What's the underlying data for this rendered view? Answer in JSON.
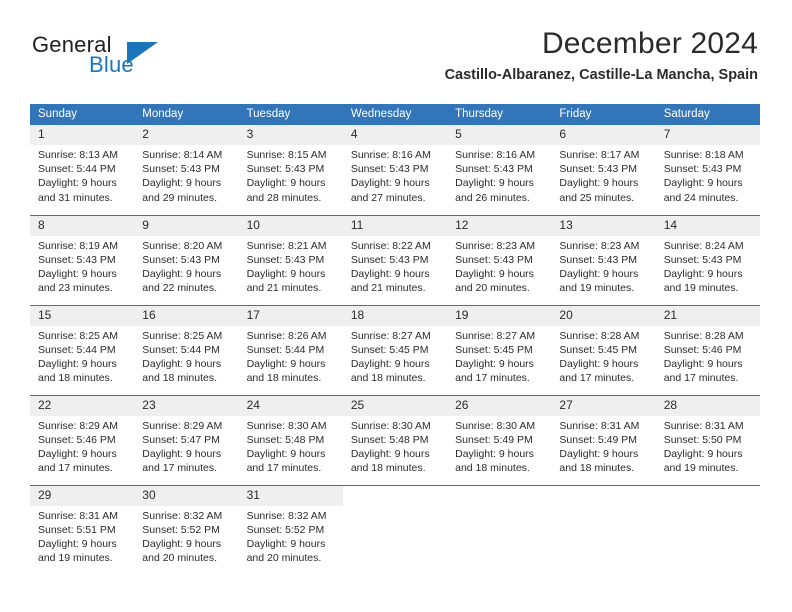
{
  "logo": {
    "word_one": "General",
    "word_two": "Blue",
    "triangle_color": "#1b75bb"
  },
  "header": {
    "title": "December 2024",
    "subtitle": "Castillo-Albaranez, Castille-La Mancha, Spain"
  },
  "theme": {
    "header_bg": "#3275b8",
    "daynum_bg": "#efefef",
    "text": "#2b2b2b",
    "accent": "#1b75bb"
  },
  "calendar": {
    "weekday_headers": [
      "Sunday",
      "Monday",
      "Tuesday",
      "Wednesday",
      "Thursday",
      "Friday",
      "Saturday"
    ],
    "weeks": [
      [
        {
          "day": "1",
          "sunrise": "Sunrise: 8:13 AM",
          "sunset": "Sunset: 5:44 PM",
          "daylight_1": "Daylight: 9 hours",
          "daylight_2": "and 31 minutes."
        },
        {
          "day": "2",
          "sunrise": "Sunrise: 8:14 AM",
          "sunset": "Sunset: 5:43 PM",
          "daylight_1": "Daylight: 9 hours",
          "daylight_2": "and 29 minutes."
        },
        {
          "day": "3",
          "sunrise": "Sunrise: 8:15 AM",
          "sunset": "Sunset: 5:43 PM",
          "daylight_1": "Daylight: 9 hours",
          "daylight_2": "and 28 minutes."
        },
        {
          "day": "4",
          "sunrise": "Sunrise: 8:16 AM",
          "sunset": "Sunset: 5:43 PM",
          "daylight_1": "Daylight: 9 hours",
          "daylight_2": "and 27 minutes."
        },
        {
          "day": "5",
          "sunrise": "Sunrise: 8:16 AM",
          "sunset": "Sunset: 5:43 PM",
          "daylight_1": "Daylight: 9 hours",
          "daylight_2": "and 26 minutes."
        },
        {
          "day": "6",
          "sunrise": "Sunrise: 8:17 AM",
          "sunset": "Sunset: 5:43 PM",
          "daylight_1": "Daylight: 9 hours",
          "daylight_2": "and 25 minutes."
        },
        {
          "day": "7",
          "sunrise": "Sunrise: 8:18 AM",
          "sunset": "Sunset: 5:43 PM",
          "daylight_1": "Daylight: 9 hours",
          "daylight_2": "and 24 minutes."
        }
      ],
      [
        {
          "day": "8",
          "sunrise": "Sunrise: 8:19 AM",
          "sunset": "Sunset: 5:43 PM",
          "daylight_1": "Daylight: 9 hours",
          "daylight_2": "and 23 minutes."
        },
        {
          "day": "9",
          "sunrise": "Sunrise: 8:20 AM",
          "sunset": "Sunset: 5:43 PM",
          "daylight_1": "Daylight: 9 hours",
          "daylight_2": "and 22 minutes."
        },
        {
          "day": "10",
          "sunrise": "Sunrise: 8:21 AM",
          "sunset": "Sunset: 5:43 PM",
          "daylight_1": "Daylight: 9 hours",
          "daylight_2": "and 21 minutes."
        },
        {
          "day": "11",
          "sunrise": "Sunrise: 8:22 AM",
          "sunset": "Sunset: 5:43 PM",
          "daylight_1": "Daylight: 9 hours",
          "daylight_2": "and 21 minutes."
        },
        {
          "day": "12",
          "sunrise": "Sunrise: 8:23 AM",
          "sunset": "Sunset: 5:43 PM",
          "daylight_1": "Daylight: 9 hours",
          "daylight_2": "and 20 minutes."
        },
        {
          "day": "13",
          "sunrise": "Sunrise: 8:23 AM",
          "sunset": "Sunset: 5:43 PM",
          "daylight_1": "Daylight: 9 hours",
          "daylight_2": "and 19 minutes."
        },
        {
          "day": "14",
          "sunrise": "Sunrise: 8:24 AM",
          "sunset": "Sunset: 5:43 PM",
          "daylight_1": "Daylight: 9 hours",
          "daylight_2": "and 19 minutes."
        }
      ],
      [
        {
          "day": "15",
          "sunrise": "Sunrise: 8:25 AM",
          "sunset": "Sunset: 5:44 PM",
          "daylight_1": "Daylight: 9 hours",
          "daylight_2": "and 18 minutes."
        },
        {
          "day": "16",
          "sunrise": "Sunrise: 8:25 AM",
          "sunset": "Sunset: 5:44 PM",
          "daylight_1": "Daylight: 9 hours",
          "daylight_2": "and 18 minutes."
        },
        {
          "day": "17",
          "sunrise": "Sunrise: 8:26 AM",
          "sunset": "Sunset: 5:44 PM",
          "daylight_1": "Daylight: 9 hours",
          "daylight_2": "and 18 minutes."
        },
        {
          "day": "18",
          "sunrise": "Sunrise: 8:27 AM",
          "sunset": "Sunset: 5:45 PM",
          "daylight_1": "Daylight: 9 hours",
          "daylight_2": "and 18 minutes."
        },
        {
          "day": "19",
          "sunrise": "Sunrise: 8:27 AM",
          "sunset": "Sunset: 5:45 PM",
          "daylight_1": "Daylight: 9 hours",
          "daylight_2": "and 17 minutes."
        },
        {
          "day": "20",
          "sunrise": "Sunrise: 8:28 AM",
          "sunset": "Sunset: 5:45 PM",
          "daylight_1": "Daylight: 9 hours",
          "daylight_2": "and 17 minutes."
        },
        {
          "day": "21",
          "sunrise": "Sunrise: 8:28 AM",
          "sunset": "Sunset: 5:46 PM",
          "daylight_1": "Daylight: 9 hours",
          "daylight_2": "and 17 minutes."
        }
      ],
      [
        {
          "day": "22",
          "sunrise": "Sunrise: 8:29 AM",
          "sunset": "Sunset: 5:46 PM",
          "daylight_1": "Daylight: 9 hours",
          "daylight_2": "and 17 minutes."
        },
        {
          "day": "23",
          "sunrise": "Sunrise: 8:29 AM",
          "sunset": "Sunset: 5:47 PM",
          "daylight_1": "Daylight: 9 hours",
          "daylight_2": "and 17 minutes."
        },
        {
          "day": "24",
          "sunrise": "Sunrise: 8:30 AM",
          "sunset": "Sunset: 5:48 PM",
          "daylight_1": "Daylight: 9 hours",
          "daylight_2": "and 17 minutes."
        },
        {
          "day": "25",
          "sunrise": "Sunrise: 8:30 AM",
          "sunset": "Sunset: 5:48 PM",
          "daylight_1": "Daylight: 9 hours",
          "daylight_2": "and 18 minutes."
        },
        {
          "day": "26",
          "sunrise": "Sunrise: 8:30 AM",
          "sunset": "Sunset: 5:49 PM",
          "daylight_1": "Daylight: 9 hours",
          "daylight_2": "and 18 minutes."
        },
        {
          "day": "27",
          "sunrise": "Sunrise: 8:31 AM",
          "sunset": "Sunset: 5:49 PM",
          "daylight_1": "Daylight: 9 hours",
          "daylight_2": "and 18 minutes."
        },
        {
          "day": "28",
          "sunrise": "Sunrise: 8:31 AM",
          "sunset": "Sunset: 5:50 PM",
          "daylight_1": "Daylight: 9 hours",
          "daylight_2": "and 19 minutes."
        }
      ],
      [
        {
          "day": "29",
          "sunrise": "Sunrise: 8:31 AM",
          "sunset": "Sunset: 5:51 PM",
          "daylight_1": "Daylight: 9 hours",
          "daylight_2": "and 19 minutes."
        },
        {
          "day": "30",
          "sunrise": "Sunrise: 8:32 AM",
          "sunset": "Sunset: 5:52 PM",
          "daylight_1": "Daylight: 9 hours",
          "daylight_2": "and 20 minutes."
        },
        {
          "day": "31",
          "sunrise": "Sunrise: 8:32 AM",
          "sunset": "Sunset: 5:52 PM",
          "daylight_1": "Daylight: 9 hours",
          "daylight_2": "and 20 minutes."
        },
        {
          "day": "",
          "sunrise": "",
          "sunset": "",
          "daylight_1": "",
          "daylight_2": ""
        },
        {
          "day": "",
          "sunrise": "",
          "sunset": "",
          "daylight_1": "",
          "daylight_2": ""
        },
        {
          "day": "",
          "sunrise": "",
          "sunset": "",
          "daylight_1": "",
          "daylight_2": ""
        },
        {
          "day": "",
          "sunrise": "",
          "sunset": "",
          "daylight_1": "",
          "daylight_2": ""
        }
      ]
    ]
  }
}
